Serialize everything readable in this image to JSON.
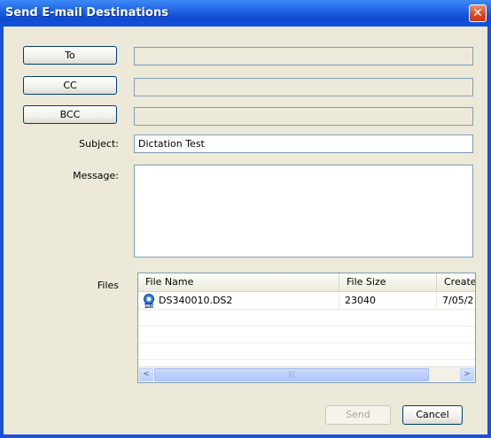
{
  "window": {
    "title": "Send E-mail Destinations",
    "close_glyph": "✕"
  },
  "recipients": {
    "to_label": "To",
    "to_value": "",
    "cc_label": "CC",
    "cc_value": "",
    "bcc_label": "BCC",
    "bcc_value": ""
  },
  "subject": {
    "label": "Subject:",
    "value": "Dictation Test"
  },
  "message": {
    "label": "Message:",
    "value": ""
  },
  "files": {
    "label": "Files",
    "columns": [
      "File Name",
      "File Size",
      "Create"
    ],
    "rows": [
      {
        "name": "DS340010.DS2",
        "size": "23040",
        "created": "7/05/2",
        "icon": "ds2-pro-file-icon"
      }
    ]
  },
  "footer": {
    "send_label": "Send",
    "cancel_label": "Cancel"
  },
  "scrollbar": {
    "left_arrow": "<",
    "right_arrow": ">",
    "grip": "|||"
  }
}
